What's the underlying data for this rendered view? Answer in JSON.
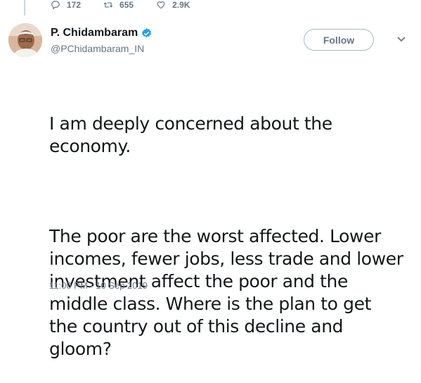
{
  "previous_tweet": {
    "replies": "172",
    "retweets": "655",
    "likes": "2.9K"
  },
  "tweet": {
    "display_name": "P. Chidambaram",
    "handle": "@PChidambaram_IN",
    "verified": true,
    "follow_label": "Follow",
    "paragraphs": [
      "I am deeply concerned about the\neconomy.",
      "The poor are the worst affected. Lower\nincomes, fewer jobs, less trade and lower\ninvestment affect the poor and the\nmiddle class. Where is the plan to get\nthe country out of this decline and\ngloom?"
    ],
    "timestamp": "11:00 PM - 10 Sep 2019"
  },
  "colors": {
    "verified": "#1da1f2",
    "secondary_text": "#657786",
    "thread_line": "#ccd6dd"
  },
  "icons": {
    "reply": "reply-icon",
    "retweet": "retweet-icon",
    "like": "heart-icon",
    "verified": "verified-badge-icon",
    "more": "chevron-down-icon"
  }
}
